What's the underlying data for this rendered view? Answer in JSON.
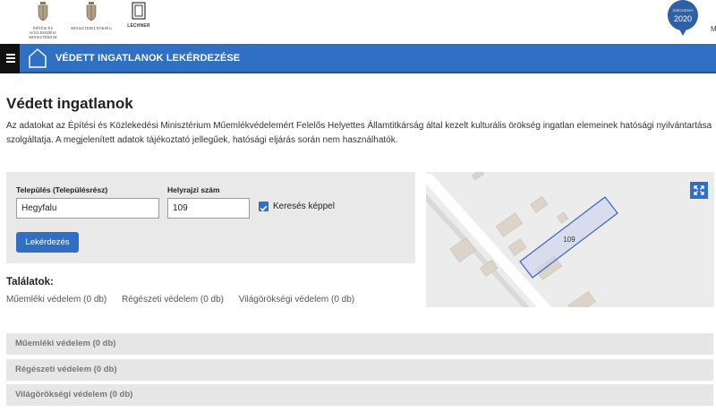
{
  "logos": {
    "ministry": "ÉPÍTÉSI ÉS KÖZLEKEDÉSI\nMINISZTÉRIUM",
    "office": "MINISZTERELNÖKSÉG",
    "lechner": "LECHNER"
  },
  "szechenyi": {
    "text": "SZÉCHENYI",
    "year": "2020"
  },
  "corner_letter": "M",
  "header": {
    "title": "VÉDETT INGATLANOK LEKÉRDEZÉSE"
  },
  "page": {
    "title": "Védett ingatlanok",
    "intro": "Az adatokat az Építési és Közlekedési Minisztérium Műemlékvédelemért Felelős Helyettes Államtitkárság által kezelt kulturális örökség ingatlan elemeinek hatósági nyilvántartása szolgáltatja. A megjelenített adatok tájékoztató jellegűek, hatósági eljárás során nem használhatók."
  },
  "form": {
    "settlement_label": "Település (Településrész)",
    "settlement_value": "Hegyfalu",
    "parcel_label": "Helyrajzi szám",
    "parcel_value": "109",
    "image_search_label": "Keresés képpel",
    "image_search_checked": true,
    "submit_label": "Lekérdezés"
  },
  "results": {
    "title": "Találatok:",
    "counts": [
      "Műemléki védelem (0 db)",
      "Régészeti védelem (0 db)",
      "Világörökségi védelem (0 db)"
    ]
  },
  "map": {
    "parcel_label": "109"
  },
  "accordions": [
    "Műemléki védelem (0 db)",
    "Régészeti védelem (0 db)",
    "Világörökségi védelem (0 db)"
  ],
  "colors": {
    "primary": "#2f6fc4",
    "header_dark": "#111111",
    "panel": "#e9e9e9",
    "map_bg": "#ececec",
    "parcel": "#3b63c9"
  }
}
